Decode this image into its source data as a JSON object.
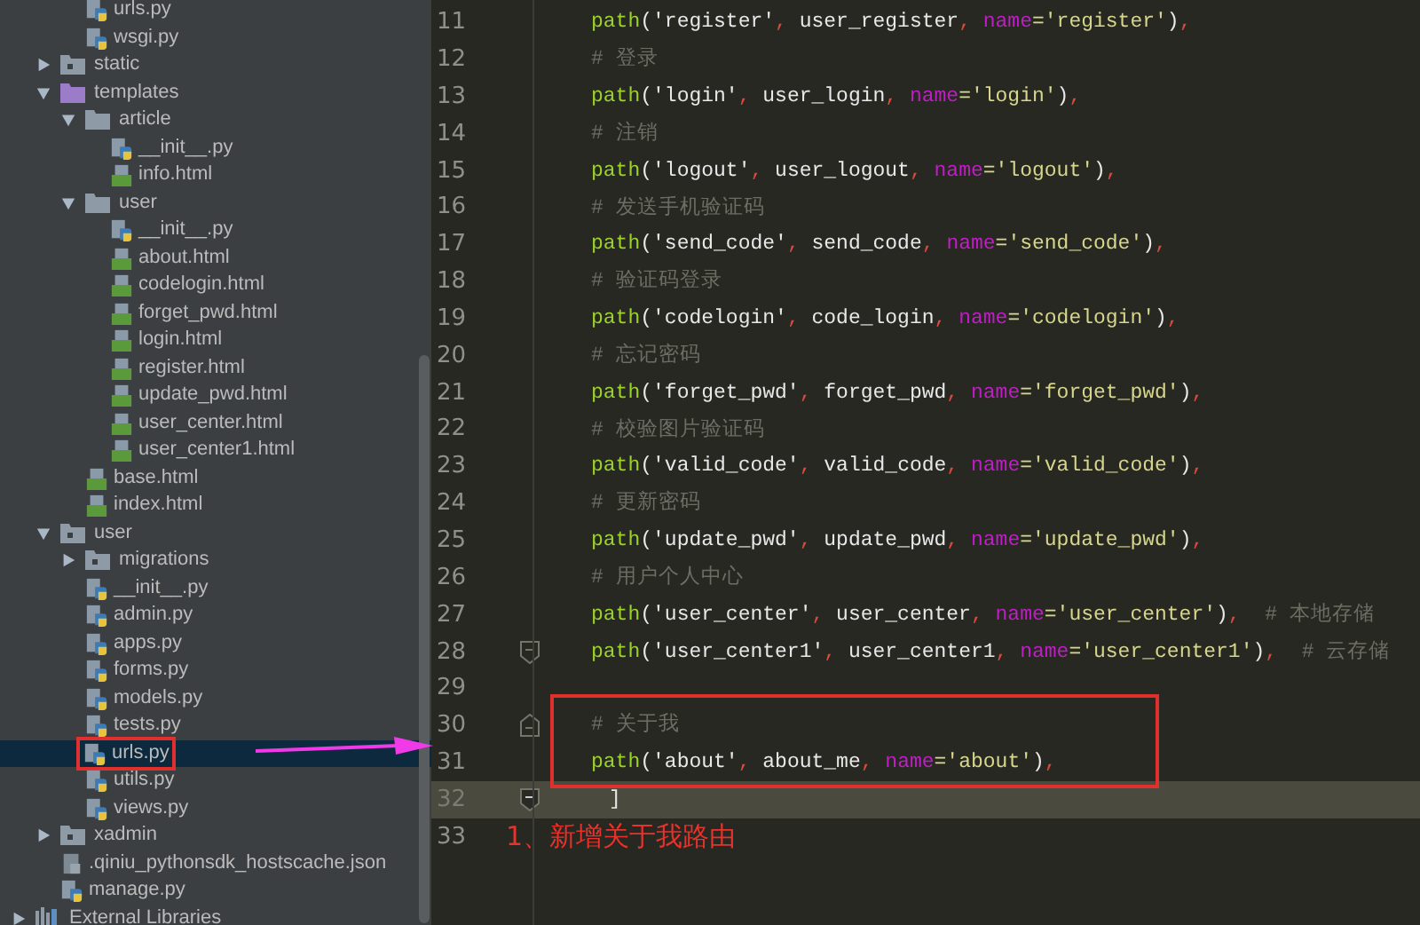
{
  "tree": [
    {
      "kind": "continued",
      "children": [
        {
          "kind": "continued",
          "children": [
            {
              "name": "urls.py",
              "kind": "py",
              "selected": false,
              "boxed": false
            },
            {
              "name": "wsgi.py",
              "kind": "py",
              "selected": false,
              "boxed": false
            }
          ]
        },
        {
          "name": "static",
          "kind": "folder",
          "expanded": false
        },
        {
          "name": "templates",
          "kind": "template-folder",
          "expanded": true,
          "children": [
            {
              "name": "article",
              "kind": "plain-folder",
              "expanded": true,
              "children": [
                {
                  "name": "__init__.py",
                  "kind": "py",
                  "selected": false,
                  "boxed": false
                },
                {
                  "name": "info.html",
                  "kind": "html",
                  "selected": false,
                  "boxed": false
                }
              ]
            },
            {
              "name": "user",
              "kind": "plain-folder",
              "expanded": true,
              "children": [
                {
                  "name": "__init__.py",
                  "kind": "py",
                  "selected": false,
                  "boxed": false
                },
                {
                  "name": "about.html",
                  "kind": "html",
                  "selected": false,
                  "boxed": false
                },
                {
                  "name": "codelogin.html",
                  "kind": "html",
                  "selected": false,
                  "boxed": false
                },
                {
                  "name": "forget_pwd.html",
                  "kind": "html",
                  "selected": false,
                  "boxed": false
                },
                {
                  "name": "login.html",
                  "kind": "html",
                  "selected": false,
                  "boxed": false
                },
                {
                  "name": "register.html",
                  "kind": "html",
                  "selected": false,
                  "boxed": false
                },
                {
                  "name": "update_pwd.html",
                  "kind": "html",
                  "selected": false,
                  "boxed": false
                },
                {
                  "name": "user_center.html",
                  "kind": "html",
                  "selected": false,
                  "boxed": false
                },
                {
                  "name": "user_center1.html",
                  "kind": "html",
                  "selected": false,
                  "boxed": false
                }
              ]
            },
            {
              "name": "base.html",
              "kind": "html",
              "selected": false,
              "boxed": false
            },
            {
              "name": "index.html",
              "kind": "html",
              "selected": false,
              "boxed": false
            }
          ]
        },
        {
          "name": "user",
          "kind": "folder",
          "expanded": true,
          "children": [
            {
              "name": "migrations",
              "kind": "folder",
              "expanded": false
            },
            {
              "name": "__init__.py",
              "kind": "py",
              "selected": false,
              "boxed": false
            },
            {
              "name": "admin.py",
              "kind": "py",
              "selected": false,
              "boxed": false
            },
            {
              "name": "apps.py",
              "kind": "py",
              "selected": false,
              "boxed": false
            },
            {
              "name": "forms.py",
              "kind": "py",
              "selected": false,
              "boxed": false
            },
            {
              "name": "models.py",
              "kind": "py",
              "selected": false,
              "boxed": false
            },
            {
              "name": "tests.py",
              "kind": "py",
              "selected": false,
              "boxed": false
            },
            {
              "name": "urls.py",
              "kind": "py",
              "selected": true,
              "boxed": true
            },
            {
              "name": "utils.py",
              "kind": "py",
              "selected": false,
              "boxed": false
            },
            {
              "name": "views.py",
              "kind": "py",
              "selected": false,
              "boxed": false
            }
          ]
        },
        {
          "name": "xadmin",
          "kind": "folder",
          "expanded": false
        },
        {
          "name": ".qiniu_pythonsdk_hostscache.json",
          "kind": "json",
          "selected": false,
          "boxed": false
        },
        {
          "name": "manage.py",
          "kind": "py",
          "selected": false,
          "boxed": false
        }
      ]
    },
    {
      "name": "External Libraries",
      "kind": "libraries",
      "expanded": false
    }
  ],
  "editor": {
    "lines": [
      {
        "number": "11",
        "current": false,
        "boxed": false,
        "tokens": [
          {
            "kind": "fn",
            "text": "path"
          },
          {
            "kind": "paren",
            "text": "("
          },
          {
            "kind": "arg",
            "text": "'register'"
          },
          {
            "kind": "comma",
            "text": ", "
          },
          {
            "kind": "arg",
            "text": "user_register"
          },
          {
            "kind": "comma",
            "text": ", "
          },
          {
            "kind": "kw",
            "text": "name"
          },
          {
            "kind": "val",
            "text": "='register'"
          },
          {
            "kind": "paren",
            "text": ")"
          },
          {
            "kind": "comma",
            "text": ","
          }
        ]
      },
      {
        "number": "12",
        "current": false,
        "boxed": false,
        "tokens": [
          {
            "kind": "comment",
            "text": "# 登录"
          }
        ]
      },
      {
        "number": "13",
        "current": false,
        "boxed": false,
        "tokens": [
          {
            "kind": "fn",
            "text": "path"
          },
          {
            "kind": "paren",
            "text": "("
          },
          {
            "kind": "arg",
            "text": "'login'"
          },
          {
            "kind": "comma",
            "text": ", "
          },
          {
            "kind": "arg",
            "text": "user_login"
          },
          {
            "kind": "comma",
            "text": ", "
          },
          {
            "kind": "kw",
            "text": "name"
          },
          {
            "kind": "val",
            "text": "='login'"
          },
          {
            "kind": "paren",
            "text": ")"
          },
          {
            "kind": "comma",
            "text": ","
          }
        ]
      },
      {
        "number": "14",
        "current": false,
        "boxed": false,
        "tokens": [
          {
            "kind": "comment",
            "text": "# 注销"
          }
        ]
      },
      {
        "number": "15",
        "current": false,
        "boxed": false,
        "tokens": [
          {
            "kind": "fn",
            "text": "path"
          },
          {
            "kind": "paren",
            "text": "("
          },
          {
            "kind": "arg",
            "text": "'logout'"
          },
          {
            "kind": "comma",
            "text": ", "
          },
          {
            "kind": "arg",
            "text": "user_logout"
          },
          {
            "kind": "comma",
            "text": ", "
          },
          {
            "kind": "kw",
            "text": "name"
          },
          {
            "kind": "val",
            "text": "='logout'"
          },
          {
            "kind": "paren",
            "text": ")"
          },
          {
            "kind": "comma",
            "text": ","
          }
        ]
      },
      {
        "number": "16",
        "current": false,
        "boxed": false,
        "tokens": [
          {
            "kind": "comment",
            "text": "# 发送手机验证码"
          }
        ]
      },
      {
        "number": "17",
        "current": false,
        "boxed": false,
        "tokens": [
          {
            "kind": "fn",
            "text": "path"
          },
          {
            "kind": "paren",
            "text": "("
          },
          {
            "kind": "arg",
            "text": "'send_code'"
          },
          {
            "kind": "comma",
            "text": ", "
          },
          {
            "kind": "arg",
            "text": "send_code"
          },
          {
            "kind": "comma",
            "text": ", "
          },
          {
            "kind": "kw",
            "text": "name"
          },
          {
            "kind": "val",
            "text": "='send_code'"
          },
          {
            "kind": "paren",
            "text": ")"
          },
          {
            "kind": "comma",
            "text": ","
          }
        ]
      },
      {
        "number": "18",
        "current": false,
        "boxed": false,
        "tokens": [
          {
            "kind": "comment",
            "text": "# 验证码登录"
          }
        ]
      },
      {
        "number": "19",
        "current": false,
        "boxed": false,
        "tokens": [
          {
            "kind": "fn",
            "text": "path"
          },
          {
            "kind": "paren",
            "text": "("
          },
          {
            "kind": "arg",
            "text": "'codelogin'"
          },
          {
            "kind": "comma",
            "text": ", "
          },
          {
            "kind": "arg",
            "text": "code_login"
          },
          {
            "kind": "comma",
            "text": ", "
          },
          {
            "kind": "kw",
            "text": "name"
          },
          {
            "kind": "val",
            "text": "='codelogin'"
          },
          {
            "kind": "paren",
            "text": ")"
          },
          {
            "kind": "comma",
            "text": ","
          }
        ]
      },
      {
        "number": "20",
        "current": false,
        "boxed": false,
        "tokens": [
          {
            "kind": "comment",
            "text": "# 忘记密码"
          }
        ]
      },
      {
        "number": "21",
        "current": false,
        "boxed": false,
        "tokens": [
          {
            "kind": "fn",
            "text": "path"
          },
          {
            "kind": "paren",
            "text": "("
          },
          {
            "kind": "arg",
            "text": "'forget_pwd'"
          },
          {
            "kind": "comma",
            "text": ", "
          },
          {
            "kind": "arg",
            "text": "forget_pwd"
          },
          {
            "kind": "comma",
            "text": ", "
          },
          {
            "kind": "kw",
            "text": "name"
          },
          {
            "kind": "val",
            "text": "='forget_pwd'"
          },
          {
            "kind": "paren",
            "text": ")"
          },
          {
            "kind": "comma",
            "text": ","
          }
        ]
      },
      {
        "number": "22",
        "current": false,
        "boxed": false,
        "tokens": [
          {
            "kind": "comment",
            "text": "# 校验图片验证码"
          }
        ]
      },
      {
        "number": "23",
        "current": false,
        "boxed": false,
        "tokens": [
          {
            "kind": "fn",
            "text": "path"
          },
          {
            "kind": "paren",
            "text": "("
          },
          {
            "kind": "arg",
            "text": "'valid_code'"
          },
          {
            "kind": "comma",
            "text": ", "
          },
          {
            "kind": "arg",
            "text": "valid_code"
          },
          {
            "kind": "comma",
            "text": ", "
          },
          {
            "kind": "kw",
            "text": "name"
          },
          {
            "kind": "val",
            "text": "='valid_code'"
          },
          {
            "kind": "paren",
            "text": ")"
          },
          {
            "kind": "comma",
            "text": ","
          }
        ]
      },
      {
        "number": "24",
        "current": false,
        "boxed": false,
        "tokens": [
          {
            "kind": "comment",
            "text": "# 更新密码"
          }
        ]
      },
      {
        "number": "25",
        "current": false,
        "boxed": false,
        "tokens": [
          {
            "kind": "fn",
            "text": "path"
          },
          {
            "kind": "paren",
            "text": "("
          },
          {
            "kind": "arg",
            "text": "'update_pwd'"
          },
          {
            "kind": "comma",
            "text": ", "
          },
          {
            "kind": "arg",
            "text": "update_pwd"
          },
          {
            "kind": "comma",
            "text": ", "
          },
          {
            "kind": "kw",
            "text": "name"
          },
          {
            "kind": "val",
            "text": "='update_pwd'"
          },
          {
            "kind": "paren",
            "text": ")"
          },
          {
            "kind": "comma",
            "text": ","
          }
        ]
      },
      {
        "number": "26",
        "current": false,
        "boxed": false,
        "tokens": [
          {
            "kind": "comment",
            "text": "# 用户个人中心"
          }
        ]
      },
      {
        "number": "27",
        "current": false,
        "boxed": false,
        "tokens": [
          {
            "kind": "fn",
            "text": "path"
          },
          {
            "kind": "paren",
            "text": "("
          },
          {
            "kind": "arg",
            "text": "'user_center'"
          },
          {
            "kind": "comma",
            "text": ", "
          },
          {
            "kind": "arg",
            "text": "user_center"
          },
          {
            "kind": "comma",
            "text": ", "
          },
          {
            "kind": "kw",
            "text": "name"
          },
          {
            "kind": "val",
            "text": "='user_center'"
          },
          {
            "kind": "paren",
            "text": ")"
          },
          {
            "kind": "comma",
            "text": ",  "
          },
          {
            "kind": "comment",
            "text": "# 本地存储"
          }
        ]
      },
      {
        "number": "28",
        "current": false,
        "fold": {
          "kind": "end"
        },
        "boxed": false,
        "tokens": [
          {
            "kind": "fn",
            "text": "path"
          },
          {
            "kind": "paren",
            "text": "("
          },
          {
            "kind": "arg",
            "text": "'user_center1'"
          },
          {
            "kind": "comma",
            "text": ", "
          },
          {
            "kind": "arg",
            "text": "user_center1"
          },
          {
            "kind": "comma",
            "text": ", "
          },
          {
            "kind": "kw",
            "text": "name"
          },
          {
            "kind": "val",
            "text": "='user_center1'"
          },
          {
            "kind": "paren",
            "text": ")"
          },
          {
            "kind": "comma",
            "text": ",  "
          },
          {
            "kind": "comment",
            "text": "# 云存储"
          }
        ]
      },
      {
        "number": "29",
        "current": false,
        "boxed": false
      },
      {
        "number": "30",
        "current": false,
        "fold": {
          "kind": "start"
        },
        "boxed": true,
        "tokens": [
          {
            "kind": "comment",
            "text": "# 关于我"
          }
        ]
      },
      {
        "number": "31",
        "current": false,
        "boxed": true,
        "tokens": [
          {
            "kind": "fn",
            "text": "path"
          },
          {
            "kind": "paren",
            "text": "("
          },
          {
            "kind": "arg",
            "text": "'about'"
          },
          {
            "kind": "comma",
            "text": ", "
          },
          {
            "kind": "arg",
            "text": "about_me"
          },
          {
            "kind": "comma",
            "text": ", "
          },
          {
            "kind": "kw",
            "text": "name"
          },
          {
            "kind": "val",
            "text": "='about'"
          },
          {
            "kind": "paren",
            "text": ")"
          },
          {
            "kind": "comma",
            "text": ","
          }
        ]
      },
      {
        "number": "32",
        "current": true,
        "fold": {
          "kind": "end"
        },
        "boxed": false,
        "tokens": [
          {
            "kind": "paren",
            "text": "]"
          }
        ]
      },
      {
        "number": "33",
        "current": false,
        "boxed": false,
        "note": "1、新增关于我路由"
      }
    ]
  }
}
